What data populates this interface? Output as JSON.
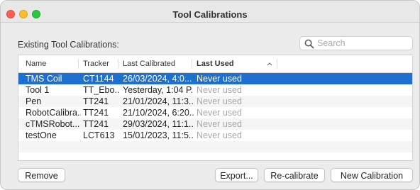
{
  "window": {
    "title": "Tool Calibrations"
  },
  "section_label": "Existing Tool Calibrations:",
  "search": {
    "placeholder": "Search",
    "value": ""
  },
  "table": {
    "columns": [
      "Name",
      "Tracker",
      "Last Calibrated",
      "Last Used"
    ],
    "sorted_column": "Last Used",
    "sort_direction": "ascending",
    "rows": [
      {
        "name": "TMS Coil",
        "tracker": "CT1144",
        "last_calibrated": "26/03/2024, 4:0...",
        "last_used": "Never used",
        "selected": true
      },
      {
        "name": "Tool 1",
        "tracker": "TT_Ebo...",
        "last_calibrated": "Yesterday, 1:04 P...",
        "last_used": "Never used",
        "selected": false
      },
      {
        "name": "Pen",
        "tracker": "TT241",
        "last_calibrated": "21/01/2024, 11:3...",
        "last_used": "Never used",
        "selected": false
      },
      {
        "name": "RobotCalibra...",
        "tracker": "TT241",
        "last_calibrated": "21/10/2024, 6:20...",
        "last_used": "Never used",
        "selected": false
      },
      {
        "name": "cTMSRobot...",
        "tracker": "TT241",
        "last_calibrated": "29/03/2024, 11:1...",
        "last_used": "Never used",
        "selected": false
      },
      {
        "name": "testOne",
        "tracker": "LCT613",
        "last_calibrated": "15/01/2023, 11:5...",
        "last_used": "Never used",
        "selected": false
      }
    ]
  },
  "buttons": {
    "remove": "Remove",
    "export": "Export...",
    "recalibrate": "Re-calibrate",
    "new_calibration": "New Calibration"
  },
  "colors": {
    "selection": "#1f6fd1",
    "close": "#ff5f57",
    "minimize": "#febc2e",
    "maximize": "#28c840"
  }
}
